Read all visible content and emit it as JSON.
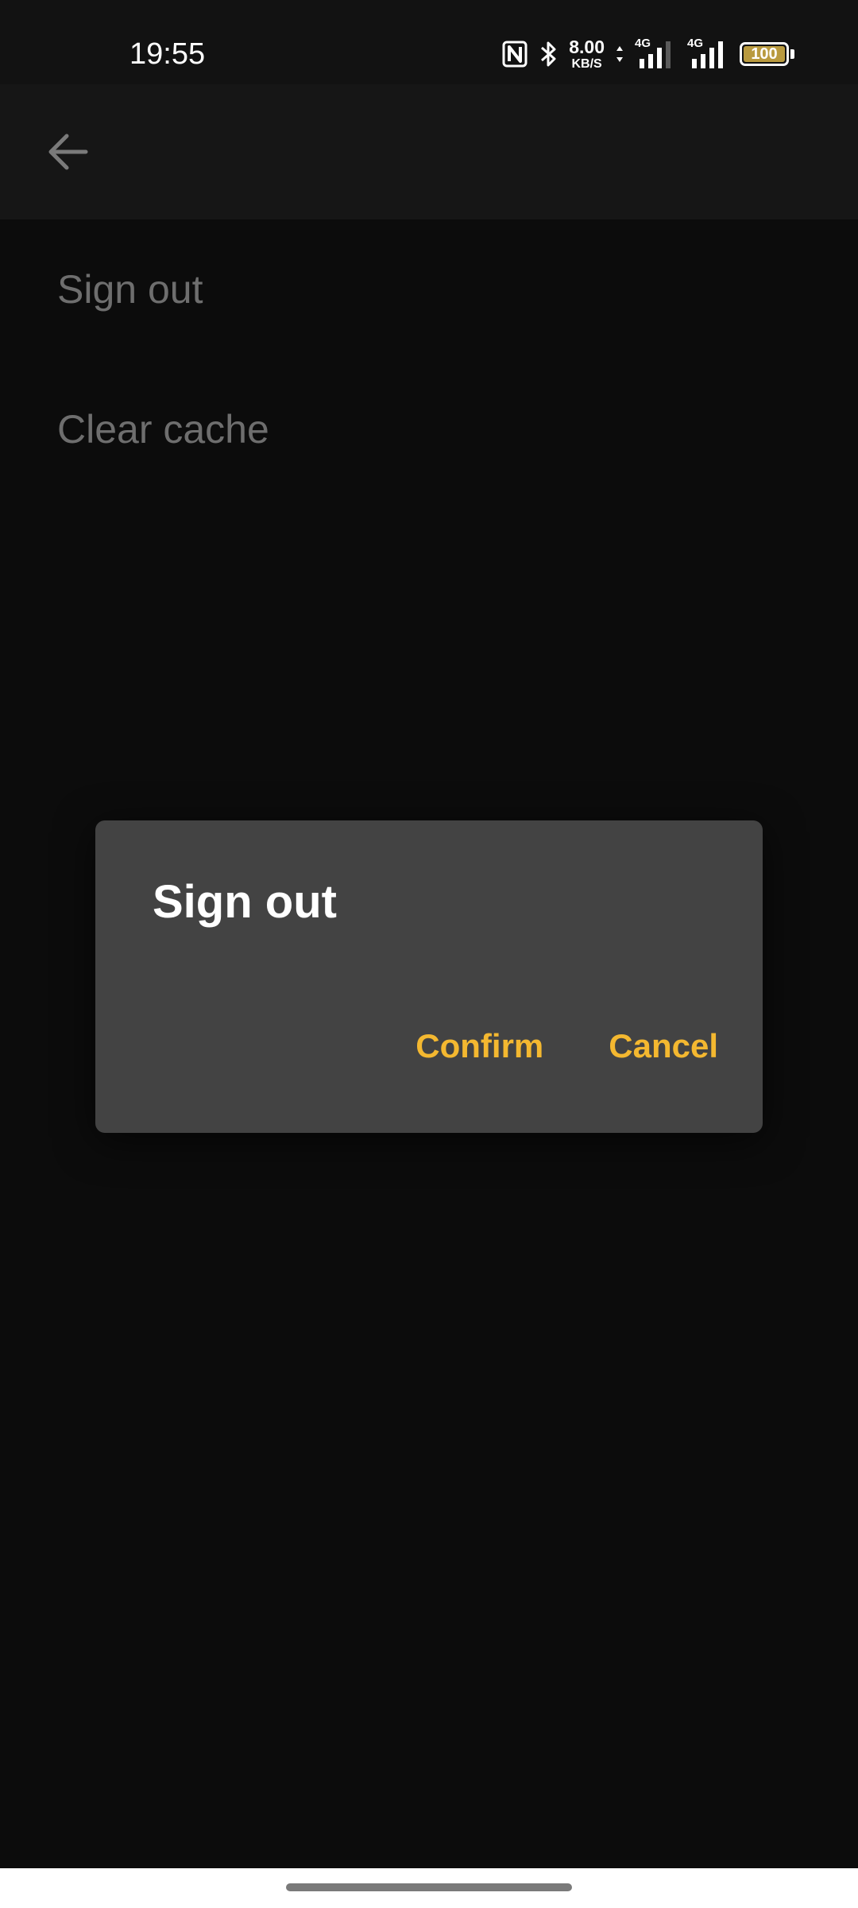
{
  "status_bar": {
    "time": "19:55",
    "network_speed_value": "8.00",
    "network_speed_unit": "KB/S",
    "network_type_1": "4G",
    "network_type_2": "4G",
    "battery_level": "100",
    "battery_percent": 100,
    "icons": [
      "nfc-icon",
      "bluetooth-icon",
      "data-arrows-icon",
      "signal-icon",
      "signal-icon",
      "battery-icon"
    ]
  },
  "app_bar": {
    "back_icon": "arrow-left-icon"
  },
  "settings": {
    "items": [
      {
        "label": "Sign out"
      },
      {
        "label": "Clear cache"
      }
    ]
  },
  "dialog": {
    "title": "Sign out",
    "confirm_label": "Confirm",
    "cancel_label": "Cancel"
  },
  "colors": {
    "accent": "#f4b830",
    "background": "#0c0c0c",
    "dialog_background": "#434343",
    "list_text": "#6e6e6e"
  }
}
